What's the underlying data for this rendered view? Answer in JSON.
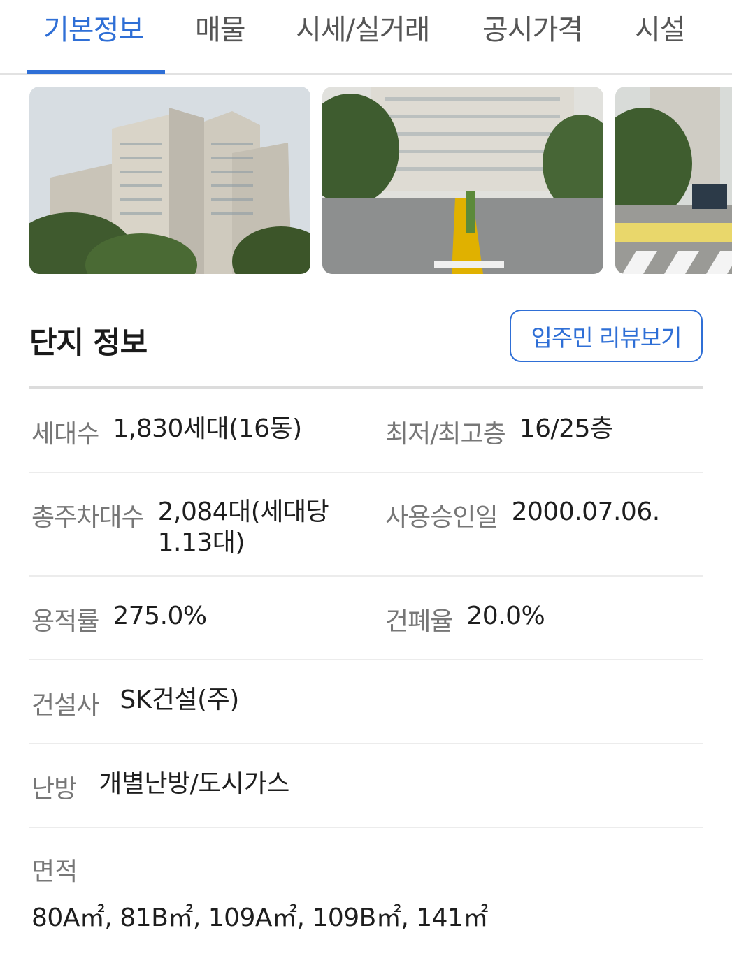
{
  "tabs": [
    {
      "label": "기본정보"
    },
    {
      "label": "매물"
    },
    {
      "label": "시세/실거래"
    },
    {
      "label": "공시가격"
    },
    {
      "label": "시설"
    }
  ],
  "section": {
    "title": "단지 정보",
    "review_button": "입주민 리뷰보기"
  },
  "info": {
    "households": {
      "label": "세대수",
      "value": "1,830세대(16동)"
    },
    "floors": {
      "label": "최저/최고층",
      "value": "16/25층"
    },
    "parking": {
      "label": "총주차대수",
      "value_line1": "2,084대(세대당",
      "value_line2": "1.13대)"
    },
    "approval_date": {
      "label": "사용승인일",
      "value": "2000.07.06."
    },
    "floor_area_ratio": {
      "label": "용적률",
      "value": "275.0%"
    },
    "building_coverage": {
      "label": "건폐율",
      "value": "20.0%"
    },
    "builder": {
      "label": "건설사",
      "value": "SK건설(주)"
    },
    "heating": {
      "label": "난방",
      "value": "개별난방/도시가스"
    },
    "area": {
      "label": "면적",
      "value": "80A㎡, 81B㎡, 109A㎡, 109B㎡, 141㎡"
    }
  },
  "colors": {
    "accent": "#2f6fd6",
    "divider": "#ececec",
    "label": "#777777"
  }
}
